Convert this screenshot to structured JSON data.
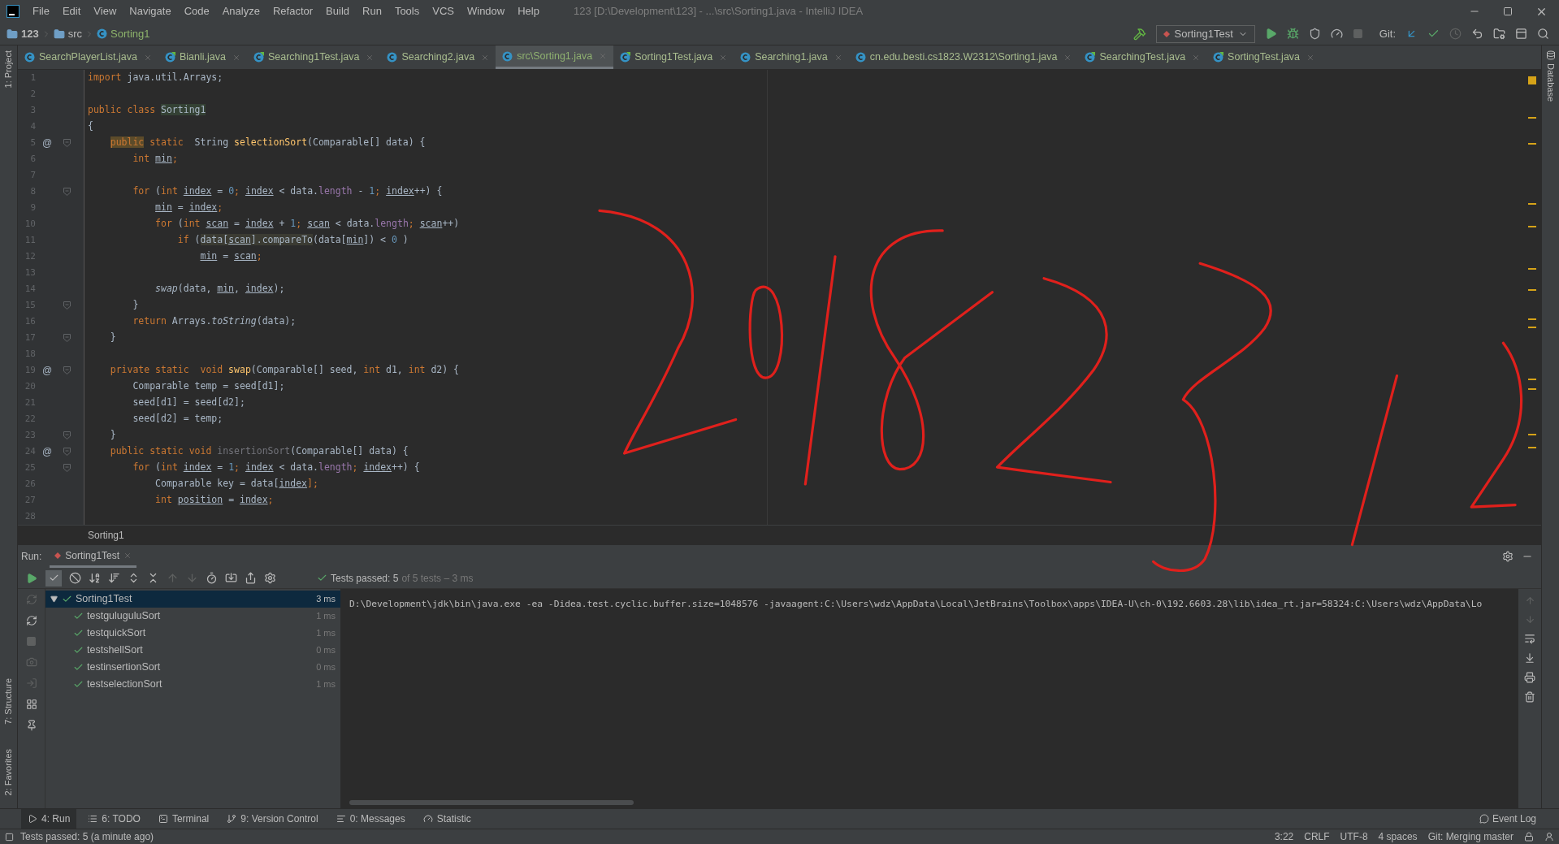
{
  "window": {
    "title": "123 [D:\\Development\\123] - ...\\src\\Sorting1.java - IntelliJ IDEA"
  },
  "menu": [
    "File",
    "Edit",
    "View",
    "Navigate",
    "Code",
    "Analyze",
    "Refactor",
    "Build",
    "Run",
    "Tools",
    "VCS",
    "Window",
    "Help"
  ],
  "navigation": {
    "breadcrumb": [
      {
        "label": "123",
        "kind": "project"
      },
      {
        "label": "src",
        "kind": "folder"
      },
      {
        "label": "Sorting1",
        "kind": "class"
      }
    ],
    "run_config": "Sorting1Test",
    "git_label": "Git:"
  },
  "left_tool_windows": [
    {
      "label": "1: Project"
    },
    {
      "label": "7: Structure"
    },
    {
      "label": "2: Favorites"
    }
  ],
  "right_tool_windows": [
    {
      "label": "Database"
    }
  ],
  "tabs": [
    {
      "label": "SearchPlayerList.java",
      "kind": "class",
      "selected": false
    },
    {
      "label": "Bianli.java",
      "kind": "test",
      "selected": false
    },
    {
      "label": "Searching1Test.java",
      "kind": "test",
      "selected": false
    },
    {
      "label": "Searching2.java",
      "kind": "class",
      "selected": false
    },
    {
      "label": "src\\Sorting1.java",
      "kind": "class",
      "selected": true
    },
    {
      "label": "Sorting1Test.java",
      "kind": "test",
      "selected": false
    },
    {
      "label": "Searching1.java",
      "kind": "class",
      "selected": false
    },
    {
      "label": "cn.edu.besti.cs1823.W2312\\Sorting1.java",
      "kind": "class",
      "selected": false
    },
    {
      "label": "SearchingTest.java",
      "kind": "test",
      "selected": false
    },
    {
      "label": "SortingTest.java",
      "kind": "test",
      "selected": false
    }
  ],
  "editor": {
    "lines": [
      {
        "number": "1",
        "fold": false,
        "tokens": [
          {
            "text": "import",
            "kind": "k"
          },
          {
            "text": " java.util.Arrays;",
            "kind": "p"
          }
        ]
      },
      {
        "number": "2",
        "fold": false
      },
      {
        "number": "3",
        "fold": false,
        "tokens": [
          {
            "text": "public class ",
            "kind": "k"
          },
          {
            "text": "Sorting1",
            "kind": "cls"
          }
        ]
      },
      {
        "number": "4",
        "fold": false,
        "tokens": [
          {
            "text": "{",
            "kind": "p"
          }
        ]
      },
      {
        "number": "5",
        "fold": true,
        "marker": "@",
        "tokens": [
          {
            "text": "    public",
            "kind": "hk"
          },
          {
            "text": " static  ",
            "kind": "k"
          },
          {
            "text": "String ",
            "kind": "p"
          },
          {
            "text": "selectionSort",
            "kind": "m"
          },
          {
            "text": "(Comparable[] data) {",
            "kind": "p"
          }
        ]
      },
      {
        "number": "6",
        "fold": false,
        "tokens": [
          {
            "text": "        int ",
            "kind": "k"
          },
          {
            "text": "min",
            "kind": "v"
          },
          {
            "text": ";",
            "kind": "k"
          }
        ]
      },
      {
        "number": "7",
        "fold": false
      },
      {
        "number": "8",
        "fold": true,
        "tokens": [
          {
            "text": "        for ",
            "kind": "k"
          },
          {
            "text": "(",
            "kind": "p"
          },
          {
            "text": "int ",
            "kind": "k"
          },
          {
            "text": "index",
            "kind": "v"
          },
          {
            "text": " = ",
            "kind": "p"
          },
          {
            "text": "0",
            "kind": "n"
          },
          {
            "text": "; ",
            "kind": "k"
          },
          {
            "text": "index",
            "kind": "v"
          },
          {
            "text": " < data.",
            "kind": "p"
          },
          {
            "text": "length",
            "kind": "f"
          },
          {
            "text": " - ",
            "kind": "p"
          },
          {
            "text": "1",
            "kind": "n"
          },
          {
            "text": "; ",
            "kind": "k"
          },
          {
            "text": "index",
            "kind": "v"
          },
          {
            "text": "++) {",
            "kind": "p"
          }
        ]
      },
      {
        "number": "9",
        "fold": false,
        "tokens": [
          {
            "text": "            min",
            "kind": "v"
          },
          {
            "text": " = ",
            "kind": "p"
          },
          {
            "text": "index",
            "kind": "v"
          },
          {
            "text": ";",
            "kind": "k"
          }
        ]
      },
      {
        "number": "10",
        "fold": false,
        "tokens": [
          {
            "text": "            for ",
            "kind": "k"
          },
          {
            "text": "(",
            "kind": "p"
          },
          {
            "text": "int ",
            "kind": "k"
          },
          {
            "text": "scan",
            "kind": "v"
          },
          {
            "text": " = ",
            "kind": "p"
          },
          {
            "text": "index",
            "kind": "v"
          },
          {
            "text": " + ",
            "kind": "p"
          },
          {
            "text": "1",
            "kind": "n"
          },
          {
            "text": "; ",
            "kind": "k"
          },
          {
            "text": "scan",
            "kind": "v"
          },
          {
            "text": " < data.",
            "kind": "p"
          },
          {
            "text": "length",
            "kind": "f"
          },
          {
            "text": "; ",
            "kind": "k"
          },
          {
            "text": "scan",
            "kind": "v"
          },
          {
            "text": "++)",
            "kind": "p"
          }
        ]
      },
      {
        "number": "11",
        "fold": false,
        "tokens": [
          {
            "text": "                if ",
            "kind": "k"
          },
          {
            "text": "(",
            "kind": "p"
          },
          {
            "text": "data[",
            "kind": "hl"
          },
          {
            "text": "scan",
            "kind": "hlv"
          },
          {
            "text": "].compareTo",
            "kind": "hl"
          },
          {
            "text": "(data[",
            "kind": "p"
          },
          {
            "text": "min",
            "kind": "v"
          },
          {
            "text": "]) < ",
            "kind": "p"
          },
          {
            "text": "0",
            "kind": "n"
          },
          {
            "text": " )",
            "kind": "p"
          }
        ]
      },
      {
        "number": "12",
        "fold": false,
        "tokens": [
          {
            "text": "                    min",
            "kind": "v"
          },
          {
            "text": " = ",
            "kind": "p"
          },
          {
            "text": "scan",
            "kind": "v"
          },
          {
            "text": ";",
            "kind": "k"
          }
        ]
      },
      {
        "number": "13",
        "fold": false
      },
      {
        "number": "14",
        "fold": false,
        "tokens": [
          {
            "text": "            swap",
            "kind": "i"
          },
          {
            "text": "(data, ",
            "kind": "p"
          },
          {
            "text": "min",
            "kind": "v"
          },
          {
            "text": ", ",
            "kind": "p"
          },
          {
            "text": "index",
            "kind": "v"
          },
          {
            "text": ");",
            "kind": "p"
          }
        ]
      },
      {
        "number": "15",
        "fold": true,
        "tokens": [
          {
            "text": "        }",
            "kind": "p"
          }
        ]
      },
      {
        "number": "16",
        "fold": false,
        "tokens": [
          {
            "text": "        return ",
            "kind": "k"
          },
          {
            "text": "Arrays.",
            "kind": "p"
          },
          {
            "text": "toString",
            "kind": "i"
          },
          {
            "text": "(data);",
            "kind": "p"
          }
        ]
      },
      {
        "number": "17",
        "fold": true,
        "tokens": [
          {
            "text": "    }",
            "kind": "p"
          }
        ]
      },
      {
        "number": "18",
        "fold": false
      },
      {
        "number": "19",
        "fold": true,
        "marker": "@",
        "tokens": [
          {
            "text": "    private static  void ",
            "kind": "k"
          },
          {
            "text": "swap",
            "kind": "m"
          },
          {
            "text": "(Comparable[] seed, ",
            "kind": "p"
          },
          {
            "text": "int ",
            "kind": "k"
          },
          {
            "text": "d1, ",
            "kind": "p"
          },
          {
            "text": "int ",
            "kind": "k"
          },
          {
            "text": "d2) {",
            "kind": "p"
          }
        ]
      },
      {
        "number": "20",
        "fold": false,
        "tokens": [
          {
            "text": "        Comparable temp = seed[d1];",
            "kind": "p"
          }
        ]
      },
      {
        "number": "21",
        "fold": false,
        "tokens": [
          {
            "text": "        seed[d1] = seed[d2];",
            "kind": "p"
          }
        ]
      },
      {
        "number": "22",
        "fold": false,
        "tokens": [
          {
            "text": "        seed[d2] = temp;",
            "kind": "p"
          }
        ]
      },
      {
        "number": "23",
        "fold": true,
        "tokens": [
          {
            "text": "    }",
            "kind": "p"
          }
        ]
      },
      {
        "number": "24",
        "fold": true,
        "marker": "@",
        "tokens": [
          {
            "text": "    public static void ",
            "kind": "k"
          },
          {
            "text": "insertionSort",
            "kind": "u"
          },
          {
            "text": "(Comparable[] data) {",
            "kind": "p"
          }
        ]
      },
      {
        "number": "25",
        "fold": true,
        "tokens": [
          {
            "text": "        for ",
            "kind": "k"
          },
          {
            "text": "(",
            "kind": "p"
          },
          {
            "text": "int ",
            "kind": "k"
          },
          {
            "text": "index",
            "kind": "v"
          },
          {
            "text": " = ",
            "kind": "p"
          },
          {
            "text": "1",
            "kind": "n"
          },
          {
            "text": "; ",
            "kind": "k"
          },
          {
            "text": "index",
            "kind": "v"
          },
          {
            "text": " < data.",
            "kind": "p"
          },
          {
            "text": "length",
            "kind": "f"
          },
          {
            "text": "; ",
            "kind": "k"
          },
          {
            "text": "index",
            "kind": "v"
          },
          {
            "text": "++) {",
            "kind": "p"
          }
        ]
      },
      {
        "number": "26",
        "fold": false,
        "tokens": [
          {
            "text": "            Comparable key = data[",
            "kind": "p"
          },
          {
            "text": "index",
            "kind": "v"
          },
          {
            "text": "];",
            "kind": "k"
          }
        ]
      },
      {
        "number": "27",
        "fold": false,
        "tokens": [
          {
            "text": "            int ",
            "kind": "k"
          },
          {
            "text": "position",
            "kind": "v"
          },
          {
            "text": " = ",
            "kind": "p"
          },
          {
            "text": "index",
            "kind": "v"
          },
          {
            "text": ";",
            "kind": "k"
          }
        ]
      },
      {
        "number": "28",
        "fold": false
      }
    ],
    "breadcrumb": "Sorting1"
  },
  "run": {
    "label": "Run:",
    "tab": "Sorting1Test",
    "summary": "Tests passed: 5",
    "summary_detail": "of 5 tests – 3 ms",
    "tree": {
      "label": "Sorting1Test",
      "time": "3 ms",
      "passed": true,
      "expanded": true,
      "selected": true,
      "children": [
        {
          "label": "testguluguluSort",
          "time": "1 ms",
          "passed": true,
          "selected": false
        },
        {
          "label": "testquickSort",
          "time": "1 ms",
          "passed": true,
          "selected": false
        },
        {
          "label": "testshellSort",
          "time": "0 ms",
          "passed": true,
          "selected": false
        },
        {
          "label": "testinsertionSort",
          "time": "0 ms",
          "passed": true,
          "selected": false
        },
        {
          "label": "testselectionSort",
          "time": "1 ms",
          "passed": true,
          "selected": false
        }
      ]
    },
    "console": "D:\\Development\\jdk\\bin\\java.exe -ea -Didea.test.cyclic.buffer.size=1048576 -javaagent:C:\\Users\\wdz\\AppData\\Local\\JetBrains\\Toolbox\\apps\\IDEA-U\\ch-0\\192.6603.28\\lib\\idea_rt.jar=58324:C:\\Users\\wdz\\AppData\\Lo"
  },
  "tool_windows": [
    {
      "label": "4: Run",
      "kind": "run",
      "selected": true
    },
    {
      "label": "6: TODO",
      "kind": "todo",
      "selected": false
    },
    {
      "label": "Terminal",
      "kind": "terminal",
      "selected": false
    },
    {
      "label": "9: Version Control",
      "kind": "vcs",
      "selected": false
    },
    {
      "label": "0: Messages",
      "kind": "messages",
      "selected": false
    },
    {
      "label": "Statistic",
      "kind": "statistic",
      "selected": false
    }
  ],
  "event_log": "Event Log",
  "status_bar": {
    "message": "Tests passed: 5 (a minute ago)",
    "items": [
      "3:22",
      "CRLF",
      "UTF-8",
      "4 spaces",
      "Git: Merging master"
    ]
  }
}
